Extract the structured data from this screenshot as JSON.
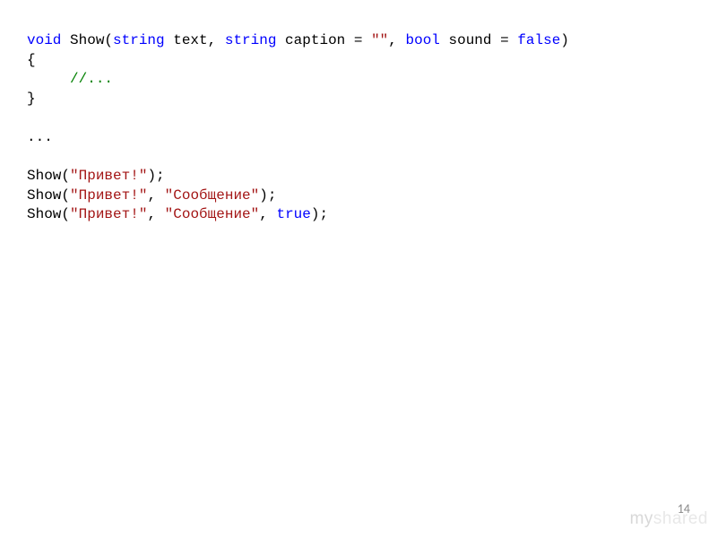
{
  "code": {
    "line1": {
      "kw_void": "void",
      "fn": " Show(",
      "kw_string1": "string",
      "p1": " text, ",
      "kw_string2": "string",
      "p2": " caption = ",
      "str_empty": "\"\"",
      "p3": ", ",
      "kw_bool": "bool",
      "p4": " sound = ",
      "kw_false": "false",
      "p5": ")"
    },
    "line2": "{",
    "line3_indent": "     ",
    "line3_cmt": "//...",
    "line4": "}",
    "blank": "",
    "line6": "...",
    "line8_a": "Show(",
    "line8_str": "\"Привет!\"",
    "line8_b": ");",
    "line9_a": "Show(",
    "line9_str1": "\"Привет!\"",
    "line9_b": ", ",
    "line9_str2": "\"Сообщение\"",
    "line9_c": ");",
    "line10_a": "Show(",
    "line10_str1": "\"Привет!\"",
    "line10_b": ", ",
    "line10_str2": "\"Сообщение\"",
    "line10_c": ", ",
    "line10_kw": "true",
    "line10_d": ");"
  },
  "page_number": "14",
  "watermark_my": "my",
  "watermark_shared": "shared"
}
